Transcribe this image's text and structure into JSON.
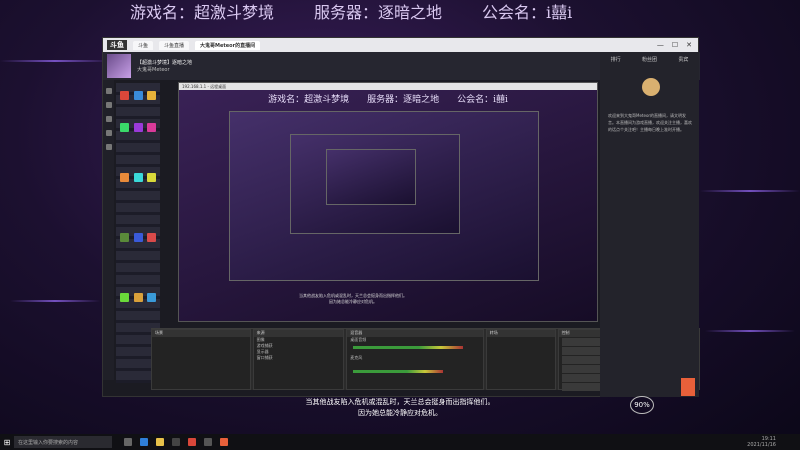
{
  "banner": {
    "game": "游戏名：超激斗梦境",
    "server": "服务器：逐暗之地",
    "guild": "公会名：i囍i"
  },
  "browser": {
    "logo": "斗鱼",
    "tabs": [
      "斗鱼",
      "斗鱼直播",
      "大鬼哥Meteor的直播间"
    ],
    "controls": [
      "—",
      "☐",
      "✕"
    ]
  },
  "page": {
    "title": "【超激斗梦境】逐暗之地",
    "streamer": "大鬼哥Meteor"
  },
  "remote": {
    "title": "192.168.1.1 - 远程桌面",
    "banner": "游戏名：超激斗梦境　　服务器：逐暗之地　　公会名：i囍i"
  },
  "small_caption": {
    "line1": "当其他战友陷入危机或混乱时，天兰总会挺身而出指挥他们。",
    "line2": "因为她总能冷静应对危机。"
  },
  "obs": {
    "scenes_header": "场景",
    "sources_header": "来源",
    "mixer_header": "混音器",
    "transitions_header": "转场",
    "controls_header": "控制",
    "sources": [
      "图像",
      "游戏捕获",
      "显示器",
      "窗口捕获"
    ],
    "mixer_tracks": [
      "桌面音频",
      "麦克风"
    ],
    "controls": [
      "开始推流",
      "开始录制",
      "启动虚拟摄像机",
      "工作室模式",
      "设置",
      "退出"
    ]
  },
  "sidebar": {
    "tabs": [
      "排行",
      "粉丝团",
      "贵宾"
    ],
    "text": "欢迎来到大鬼哥Meteor的直播间，请文明发言。本直播间为游戏直播，欢迎关注主播，喜欢的话点个关注吧！主播每日晚上准时开播。"
  },
  "bottom_caption": {
    "line1": "当其他战友陷入危机或混乱时，天兰总会挺身而出指挥他们。",
    "line2": "因为她总能冷静应对危机。"
  },
  "percent": "90%",
  "taskbar": {
    "search_placeholder": "在这里输入你要搜索的内容",
    "time": "19:11",
    "date": "2021/11/16"
  }
}
